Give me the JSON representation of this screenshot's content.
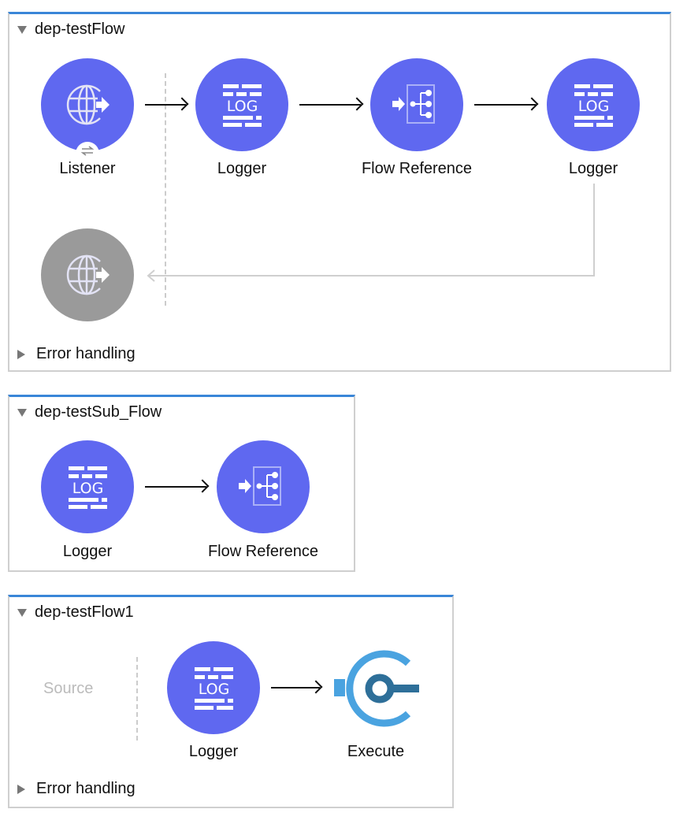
{
  "flows": [
    {
      "name": "dep-testFlow",
      "expanded": true,
      "nodes": [
        {
          "label": "Listener",
          "icon": "http-listener-icon"
        },
        {
          "label": "Logger",
          "icon": "logger-icon"
        },
        {
          "label": "Flow Reference",
          "icon": "flow-reference-icon"
        },
        {
          "label": "Logger",
          "icon": "logger-icon"
        }
      ],
      "response_icon": "http-response-icon",
      "error_handling_label": "Error handling"
    },
    {
      "name": "dep-testSub_Flow",
      "expanded": true,
      "nodes": [
        {
          "label": "Logger",
          "icon": "logger-icon"
        },
        {
          "label": "Flow Reference",
          "icon": "flow-reference-icon"
        }
      ]
    },
    {
      "name": "dep-testFlow1",
      "expanded": true,
      "source_placeholder": "Source",
      "nodes": [
        {
          "label": "Logger",
          "icon": "logger-icon"
        },
        {
          "label": "Execute",
          "icon": "execute-icon"
        }
      ],
      "error_handling_label": "Error handling"
    }
  ],
  "colors": {
    "node_fill": "#5f68f0",
    "node_disabled": "#9a9a9a",
    "flow_accent": "#3a86d8",
    "execute_light": "#4aa3e0",
    "execute_dark": "#2e6f99"
  }
}
